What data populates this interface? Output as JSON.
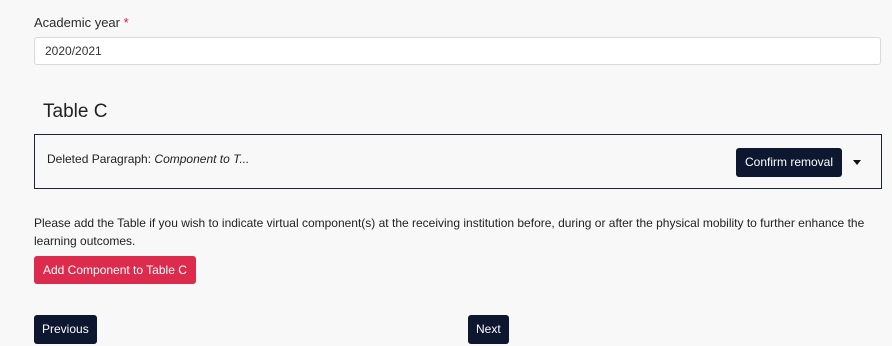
{
  "form": {
    "academic_year_label": "Academic year",
    "required_marker": "*",
    "academic_year_value": "2020/2021"
  },
  "table_c": {
    "title": "Table C",
    "deleted_prefix": "Deleted Paragraph: ",
    "deleted_name": "Component to T...",
    "confirm_removal_label": "Confirm removal",
    "help_text": "Please add the Table if you wish to indicate virtual component(s) at the receiving institution before, during or after the physical mobility to further enhance the learning outcomes.",
    "add_button_label": "Add Component to Table C"
  },
  "navigation": {
    "previous_label": "Previous",
    "next_label": "Next"
  },
  "colors": {
    "primary_dark": "#0d1730",
    "accent_red": "#dc2b4d",
    "required_red": "#dc143c",
    "background": "#f8f8f8"
  },
  "icons": {
    "dropdown": "caret-down-icon"
  }
}
